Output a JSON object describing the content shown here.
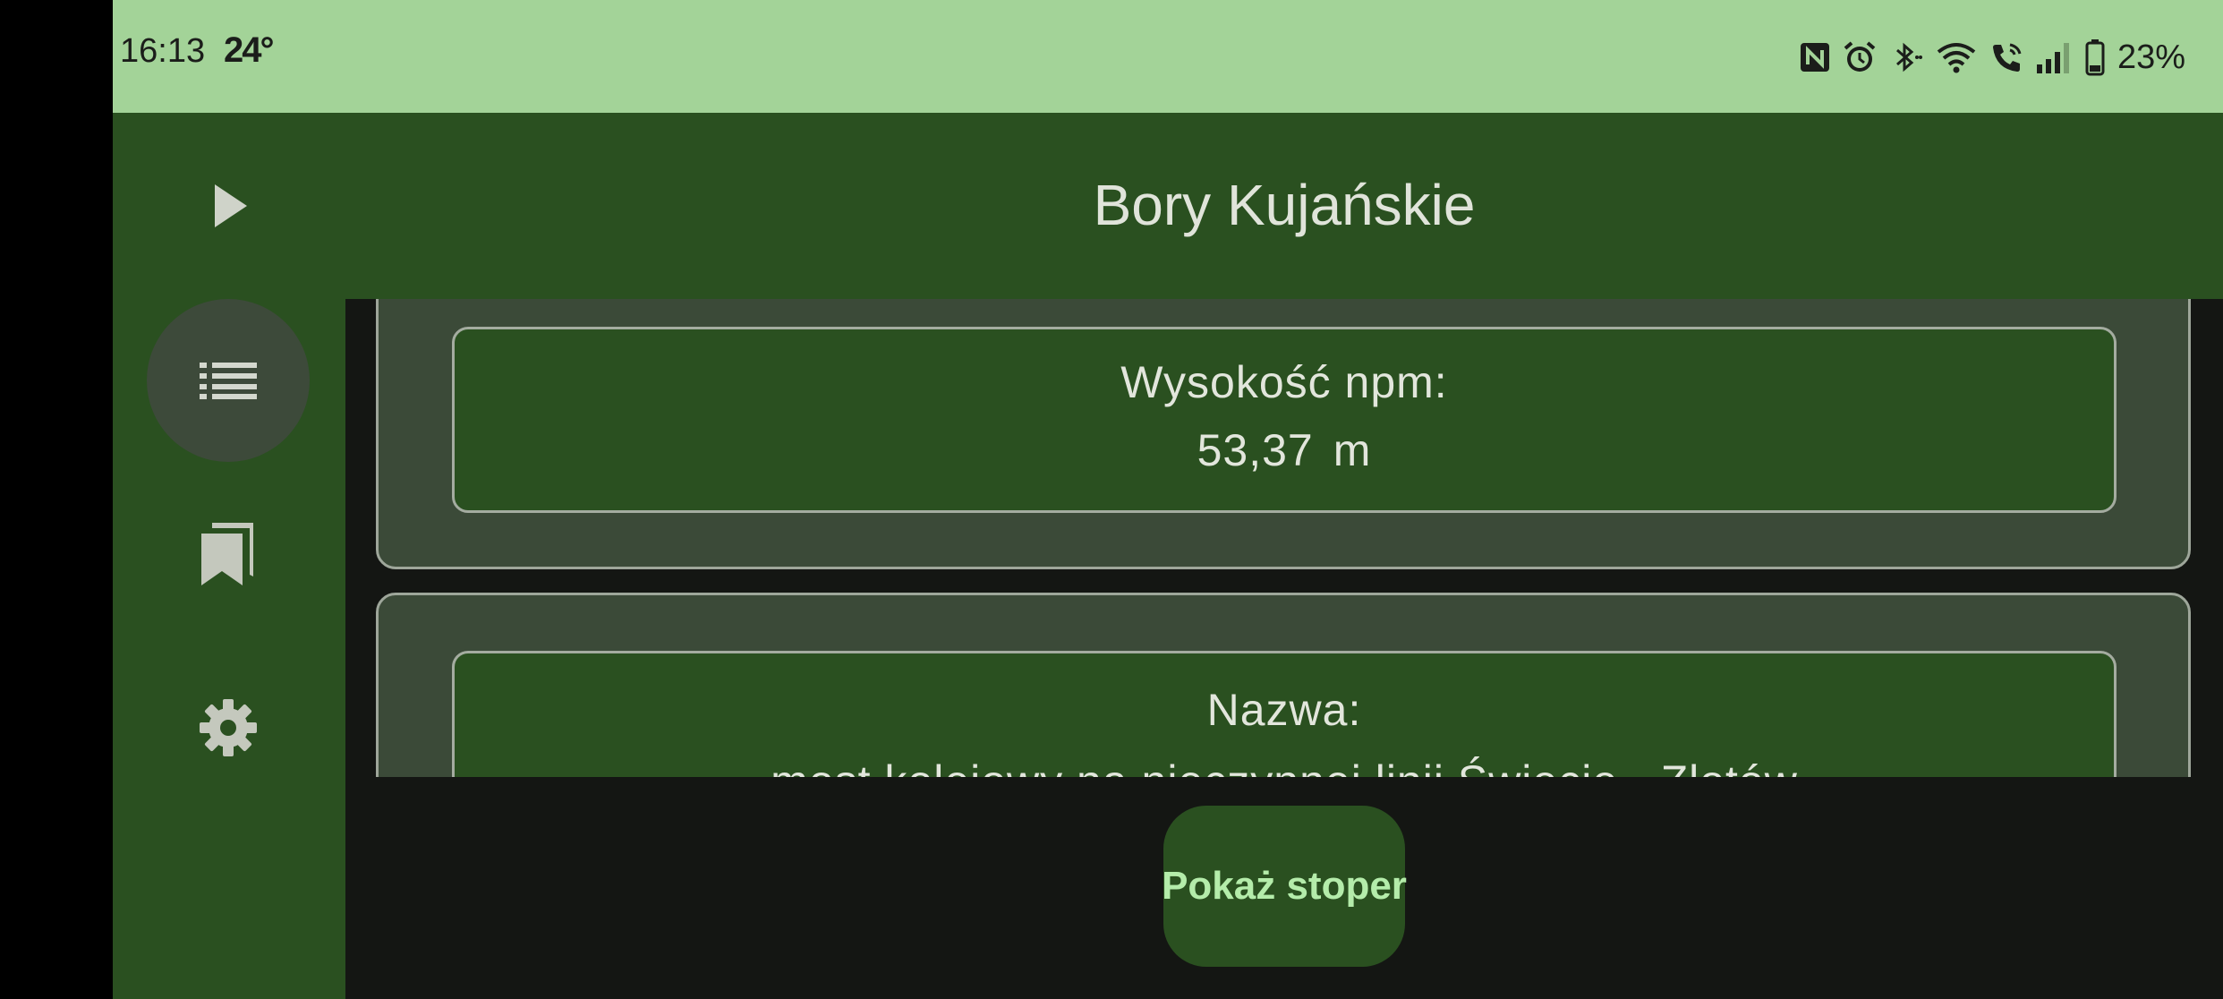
{
  "status_bar": {
    "time": "16:13",
    "temperature": "24°",
    "battery": "23%",
    "icons": [
      "nfc-icon",
      "alarm-icon",
      "bluetooth-icon",
      "wifi-icon",
      "wifi-call-icon",
      "signal-icon",
      "battery-icon"
    ]
  },
  "header": {
    "title": "Bory Kujańskie",
    "play_icon": "play-icon"
  },
  "nav_rail": {
    "items": [
      {
        "icon": "list-icon",
        "active": true
      },
      {
        "icon": "bookmarks-icon",
        "active": false
      },
      {
        "icon": "settings-icon",
        "active": false
      }
    ]
  },
  "cards": [
    {
      "label": "Wysokość npm:",
      "value": "53,37",
      "unit": "m"
    },
    {
      "label": "Nazwa:",
      "value": "most kolejowy na nieczynnej linii Świecie - Złotów"
    }
  ],
  "bottom": {
    "button_label": "Pokaż stoper"
  },
  "colors": {
    "status_bar": "#a3d398",
    "primary_dark": "#2a5020",
    "card": "#3b4a38",
    "background": "#141613",
    "button_text": "#b4ecaa"
  }
}
